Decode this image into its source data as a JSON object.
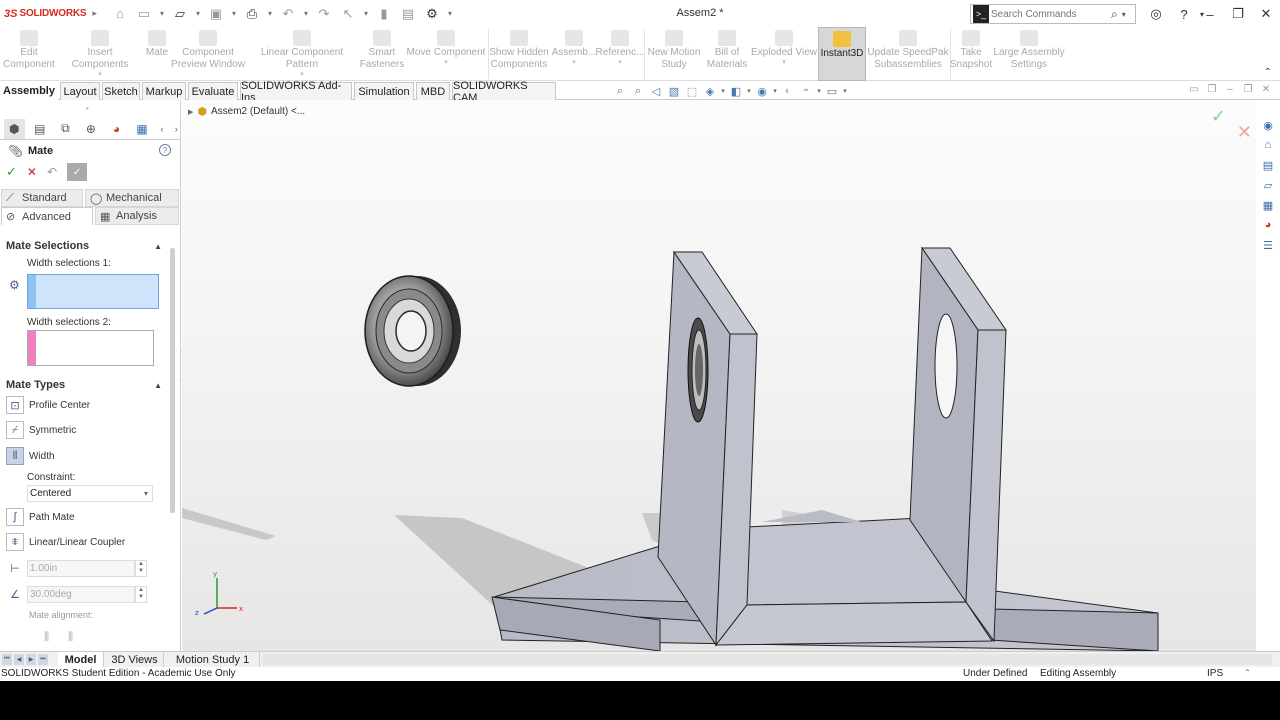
{
  "app": {
    "brand_ds": "3S",
    "brand_name": "SOLIDWORKS",
    "document_title": "Assem2 *"
  },
  "search": {
    "placeholder": "Search Commands"
  },
  "commands": [
    {
      "label": "Edit\nComponent"
    },
    {
      "label": "Insert Components"
    },
    {
      "label": "Mate"
    },
    {
      "label": "Component\nPreview Window"
    },
    {
      "label": "Linear Component Pattern"
    },
    {
      "label": "Smart\nFasteners"
    },
    {
      "label": "Move Component"
    },
    {
      "label": "Show Hidden\nComponents"
    },
    {
      "label": "Assemb..."
    },
    {
      "label": "Referenc..."
    },
    {
      "label": "New Motion\nStudy"
    },
    {
      "label": "Bill of\nMaterials"
    },
    {
      "label": "Exploded View"
    },
    {
      "label": "Instant3D"
    },
    {
      "label": "Update SpeedPak\nSubassemblies"
    },
    {
      "label": "Take\nSnapshot"
    },
    {
      "label": "Large Assembly\nSettings"
    }
  ],
  "tabs": [
    "Assembly",
    "Layout",
    "Sketch",
    "Markup",
    "Evaluate",
    "SOLIDWORKS Add-Ins",
    "Simulation",
    "MBD",
    "SOLIDWORKS CAM"
  ],
  "feature_tree": {
    "root": "Assem2 (Default) <..."
  },
  "property_manager": {
    "title": "Mate",
    "mate_tabs": {
      "standard": "Standard",
      "mechanical": "Mechanical",
      "advanced": "Advanced",
      "analysis": "Analysis"
    },
    "mate_selections": {
      "title": "Mate Selections",
      "width_sel_1": "Width selections 1:",
      "width_sel_2": "Width selections 2:"
    },
    "mate_types": {
      "title": "Mate Types",
      "profile_center": "Profile Center",
      "symmetric": "Symmetric",
      "width": "Width",
      "constraint_label": "Constraint:",
      "constraint_value": "Centered",
      "path_mate": "Path Mate",
      "linear_coupler": "Linear/Linear Coupler",
      "distance": "1.00in",
      "angle": "30.00deg",
      "mate_alignment": "Mate alignment:"
    }
  },
  "bottom_tabs": [
    "Model",
    "3D Views",
    "Motion Study 1"
  ],
  "status": {
    "edition": "SOLIDWORKS Student Edition - Academic Use Only",
    "definition": "Under Defined",
    "mode": "Editing Assembly",
    "units": "IPS"
  },
  "colors": {
    "brand_red": "#d52b1e",
    "selection_focus": "#cfe4fa",
    "selection_1_strip": "#8ec2f0",
    "selection_2_strip": "#f07ec0",
    "ok_green": "#2a9a2a",
    "cancel_red": "#cc2222",
    "part_face": "#b8bcc8"
  }
}
